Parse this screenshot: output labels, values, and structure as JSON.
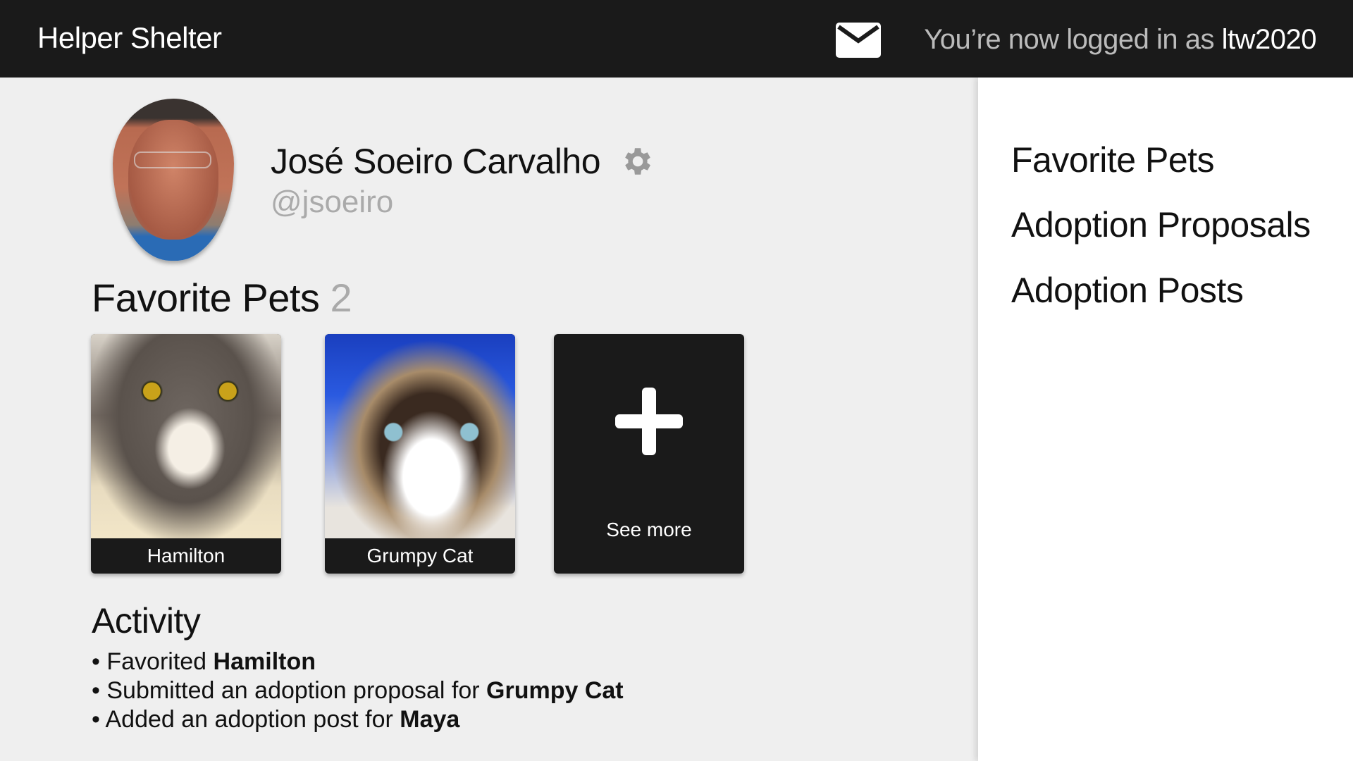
{
  "header": {
    "brand": "Helper Shelter",
    "login_prefix": "You’re now logged in as ",
    "username": "ltw2020",
    "mail_icon": "envelope-icon"
  },
  "profile": {
    "name": "José Soeiro Carvalho",
    "handle": "@jsoeiro",
    "settings_icon": "gear-icon"
  },
  "favorites": {
    "title": "Favorite Pets",
    "count": "2",
    "pets": [
      {
        "name": "Hamilton"
      },
      {
        "name": "Grumpy Cat"
      }
    ],
    "see_more": "See more"
  },
  "activity": {
    "title": "Activity",
    "items": [
      {
        "bullet": "•",
        "text": "Favorited ",
        "bold": "Hamilton"
      },
      {
        "bullet": "•",
        "text": "Submitted an adoption proposal for ",
        "bold": "Grumpy Cat"
      },
      {
        "bullet": "•",
        "text": "Added an adoption post for ",
        "bold": "Maya"
      }
    ]
  },
  "sidebar": {
    "links": [
      {
        "label": "Favorite Pets"
      },
      {
        "label": "Adoption Proposals"
      },
      {
        "label": "Adoption Posts"
      }
    ]
  }
}
